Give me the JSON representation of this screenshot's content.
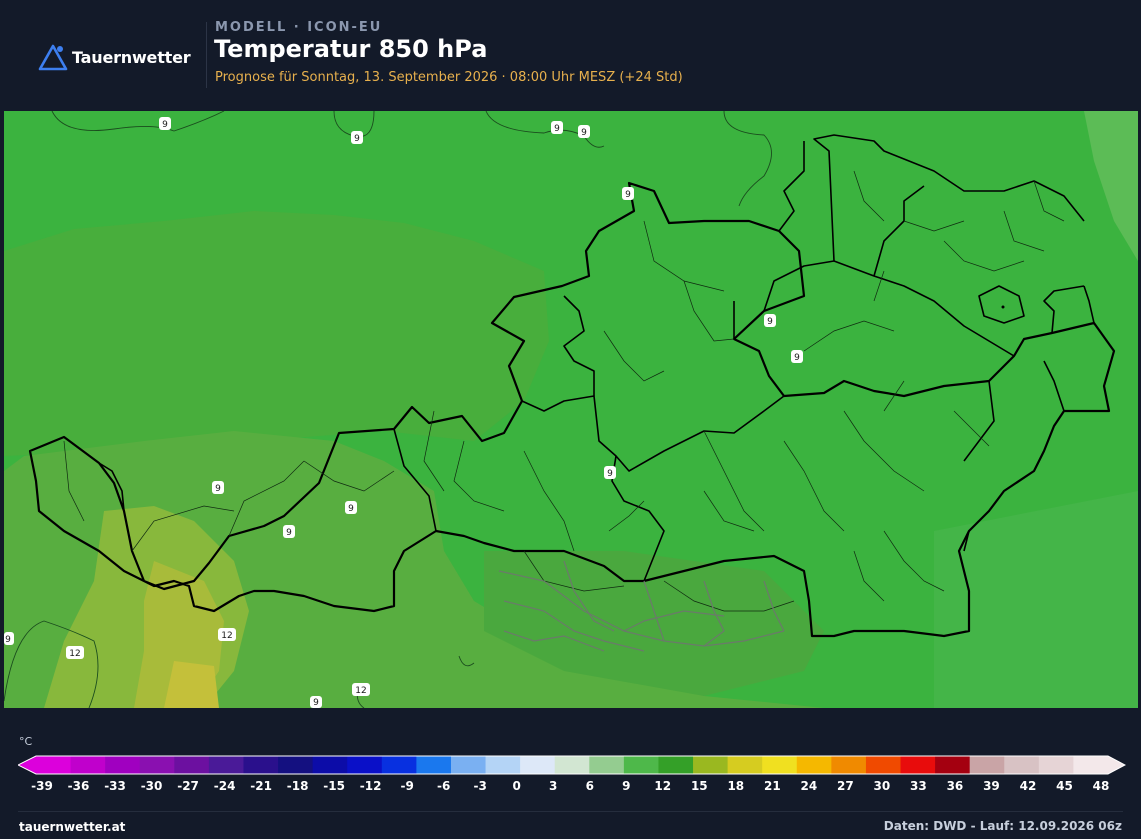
{
  "header": {
    "brand": "Tauernwetter",
    "model_label": "MODELL · ICON-EU",
    "title": "Temperatur 850 hPa",
    "subtitle": "Prognose für Sonntag, 13. September 2026 · 08:00 Uhr MESZ  (+24 Std)"
  },
  "map": {
    "isoline_labels": [
      {
        "text": "9"
      },
      {
        "text": "9"
      },
      {
        "text": "9"
      },
      {
        "text": "9"
      },
      {
        "text": "9"
      },
      {
        "text": "9"
      },
      {
        "text": "9"
      },
      {
        "text": "9"
      },
      {
        "text": "9"
      },
      {
        "text": "9"
      },
      {
        "text": "9"
      },
      {
        "text": "9"
      },
      {
        "text": "9"
      },
      {
        "text": "12"
      },
      {
        "text": "12"
      },
      {
        "text": "12"
      },
      {
        "text": "9"
      }
    ]
  },
  "legend": {
    "unit": "°C",
    "ticks": [
      "-39",
      "-36",
      "-33",
      "-30",
      "-27",
      "-24",
      "-21",
      "-18",
      "-15",
      "-12",
      "-9",
      "-6",
      "-3",
      "0",
      "3",
      "6",
      "9",
      "12",
      "15",
      "18",
      "21",
      "24",
      "27",
      "30",
      "33",
      "36",
      "39",
      "42",
      "45",
      "48"
    ],
    "colors": [
      "#dc00dc",
      "#c000cc",
      "#a000c0",
      "#8a10b0",
      "#6c10a0",
      "#4a1a98",
      "#2a108c",
      "#141080",
      "#0c0ca8",
      "#0a10c8",
      "#0830e0",
      "#1a78ee",
      "#7ab0f2",
      "#b4d4f6",
      "#dde8f8",
      "#d2e6d2",
      "#94cc90",
      "#4eb84a",
      "#34a028",
      "#9ab820",
      "#d6cc20",
      "#f0e020",
      "#f5b800",
      "#f08a00",
      "#f04a00",
      "#e80c0c",
      "#a40010",
      "#c9a4a6",
      "#d8c2c4",
      "#e6d4d6",
      "#f3e8ea"
    ]
  },
  "footer": {
    "site": "tauernwetter.at",
    "source": "Daten: DWD - Lauf: 12.09.2026 06z"
  },
  "colors": {
    "background": "#131a29",
    "map_green": "#3bb33f",
    "subtitle_accent": "#e7b04d"
  }
}
